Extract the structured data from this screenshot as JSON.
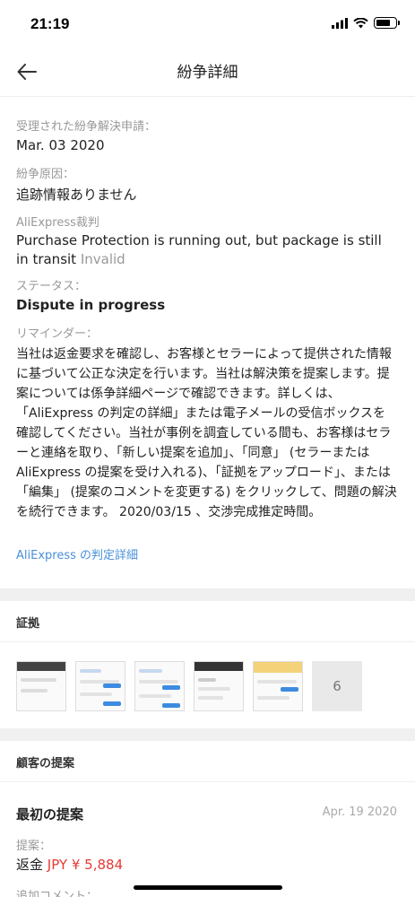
{
  "status_bar": {
    "time": "21:19",
    "battery_level": 0.75
  },
  "nav": {
    "title": "紛争詳細",
    "back_icon": "arrow-left-icon"
  },
  "details": {
    "date_label": "受理された紛争解決申請：",
    "date_value": "Mar. 03 2020",
    "reason_label": "紛争原因：",
    "reason_value": "追跡情報ありません",
    "verdict_label": "AliExpress裁判",
    "verdict_value": "Purchase Protection is running out, but package is still in transit",
    "verdict_status": "Invalid",
    "status_label": "ステータス：",
    "status_value": "Dispute in progress",
    "reminder_label": "リマインダー：",
    "reminder_text": "当社は返金要求を確認し、お客様とセラーによって提供された情報に基づいて公正な決定を行います。当社は解決策を提案します。提案については係争詳細ページで確認できます。詳しくは、「AliExpress の判定の詳細」または電子メールの受信ボックスを確認してください。当社が事例を調査している間も、お客様はセラーと連絡を取り、「新しい提案を追加」、「同意」 (セラーまたは AliExpress の提案を受け入れる)、「証拠をアップロード」、または「編集」 (提案のコメントを変更する) をクリックして、問題の解決を続行できます。 2020/03/15 、交渉完成推定時間。",
    "verdict_link": "AliExpress の判定詳細"
  },
  "evidence": {
    "header": "証拠",
    "more_count": "6"
  },
  "proposal": {
    "header": "顧客の提案",
    "title": "最初の提案",
    "date": "Apr. 19 2020",
    "label": "提案：",
    "type": "返金",
    "amount": "JPY ¥ 5,884",
    "comment_label": "追加コメント："
  }
}
